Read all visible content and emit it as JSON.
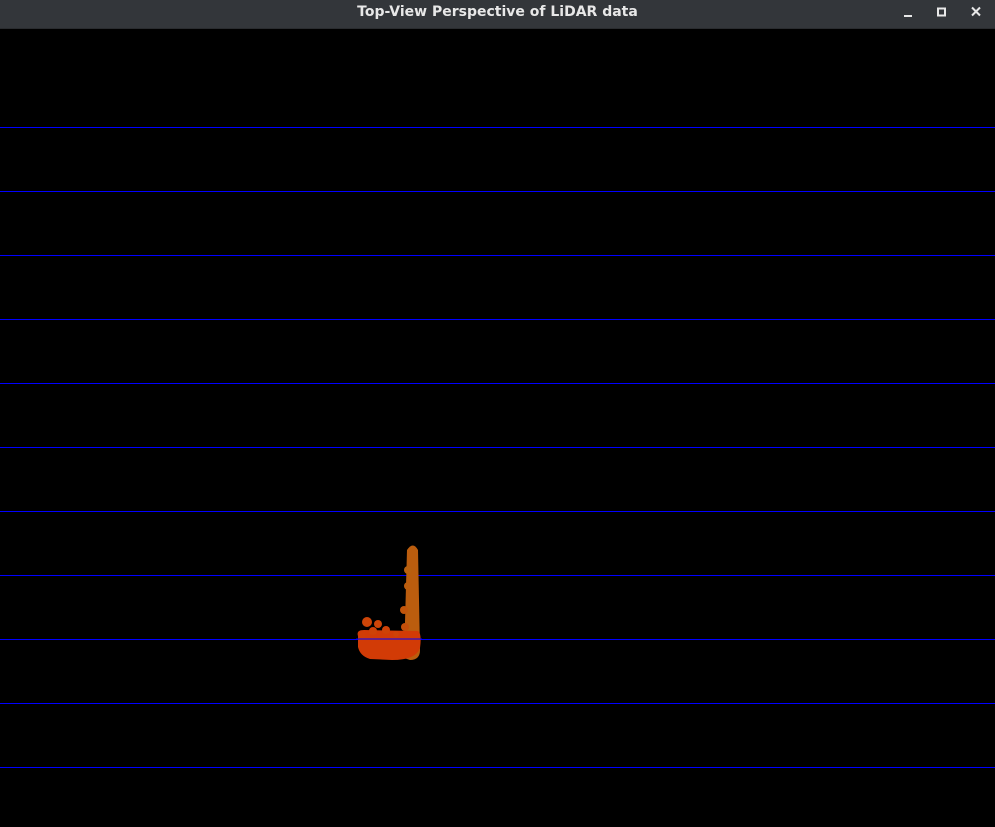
{
  "window": {
    "title": "Top-View Perspective of LiDAR data",
    "controls": {
      "minimize_icon": "minimize-icon",
      "maximize_icon": "maximize-icon",
      "close_icon": "close-icon"
    }
  },
  "view": {
    "background": "#000000",
    "grid_line_color": "#0000ff",
    "grid_line_count": 11,
    "point_color_near": "#d43a06",
    "point_color_far": "#b8600f"
  }
}
